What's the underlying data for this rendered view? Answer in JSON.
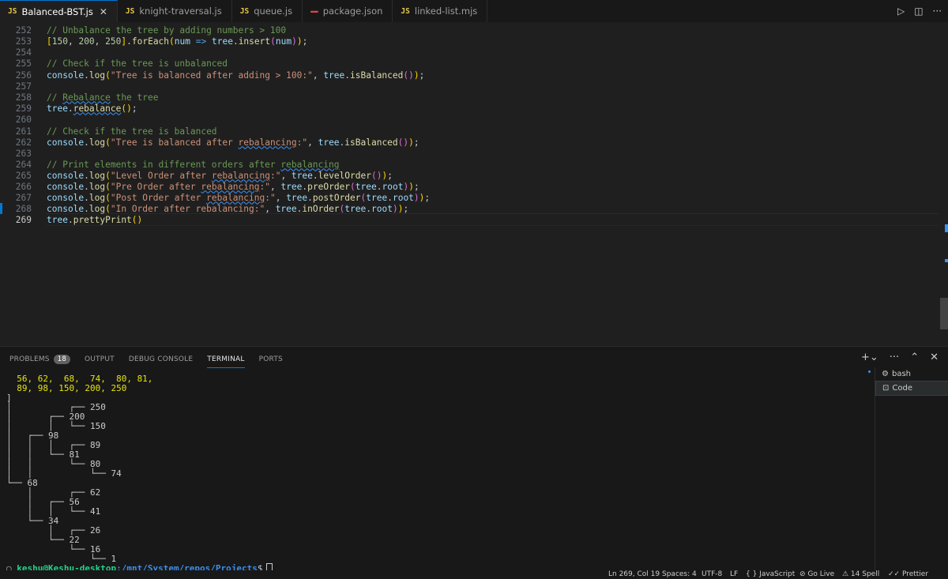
{
  "tabs": [
    {
      "icon": "JS",
      "label": "Balanced-BST.js",
      "active": true,
      "close": "✕"
    },
    {
      "icon": "JS",
      "label": "knight-traversal.js"
    },
    {
      "icon": "JS",
      "label": "queue.js"
    },
    {
      "icon": "json-icon",
      "label": "package.json"
    },
    {
      "icon": "JS",
      "label": "linked-list.mjs"
    }
  ],
  "tab_actions": {
    "run": "▷",
    "split": "◫",
    "more": "···"
  },
  "editor": {
    "lines": [
      {
        "n": "252",
        "code": "// Unbalance the tree by adding numbers > 100"
      },
      {
        "n": "253",
        "code": "[150, 200, 250].forEach(num => tree.insert(num));"
      },
      {
        "n": "254",
        "code": ""
      },
      {
        "n": "255",
        "code": "// Check if the tree is unbalanced"
      },
      {
        "n": "256",
        "code": "console.log(\"Tree is balanced after adding > 100:\", tree.isBalanced());"
      },
      {
        "n": "257",
        "code": ""
      },
      {
        "n": "258",
        "code": "// Rebalance the tree"
      },
      {
        "n": "259",
        "code": "tree.rebalance();"
      },
      {
        "n": "260",
        "code": ""
      },
      {
        "n": "261",
        "code": "// Check if the tree is balanced"
      },
      {
        "n": "262",
        "code": "console.log(\"Tree is balanced after rebalancing:\", tree.isBalanced());"
      },
      {
        "n": "263",
        "code": ""
      },
      {
        "n": "264",
        "code": "// Print elements in different orders after rebalancing"
      },
      {
        "n": "265",
        "code": "console.log(\"Level Order after rebalancing:\", tree.levelOrder());"
      },
      {
        "n": "266",
        "code": "console.log(\"Pre Order after rebalancing:\", tree.preOrder(tree.root));"
      },
      {
        "n": "267",
        "code": "console.log(\"Post Order after rebalancing:\", tree.postOrder(tree.root));"
      },
      {
        "n": "268",
        "code": "console.log(\"In Order after rebalancing:\", tree.inOrder(tree.root));"
      },
      {
        "n": "269",
        "code": "tree.prettyPrint()"
      }
    ]
  },
  "panel": {
    "tabs": [
      "PROBLEMS",
      "OUTPUT",
      "DEBUG CONSOLE",
      "TERMINAL",
      "PORTS"
    ],
    "problems_count": "18",
    "actions": [
      "+⌄",
      "···",
      "⌃",
      "✕"
    ]
  },
  "terminal": {
    "lines": [
      "  56, 62,  68,  74,  80, 81,",
      "  89, 98, 150, 200, 250",
      "]",
      "│           ┌── 250",
      "│       ┌── 200",
      "│       │   └── 150",
      "│   ┌── 98",
      "│   │   │   ┌── 89",
      "│   │   └── 81",
      "│   │       └── 80",
      "│   │           └── 74",
      "└── 68",
      "    │       ┌── 62",
      "    │   ┌── 56",
      "    │   │   └── 41",
      "    └── 34",
      "        │   ┌── 26",
      "        └── 22",
      "            └── 16",
      "                └── 1"
    ],
    "prompt_user": "keshu@Keshu-desktop",
    "prompt_path": ":/mnt/System/repos/Projects",
    "prompt_symbol": "$",
    "sessions": [
      {
        "icon": "⚙",
        "label": "bash"
      },
      {
        "icon": "⊡",
        "label": "Code",
        "active": true
      }
    ]
  },
  "status": {
    "position": "Ln 269, Col 19",
    "spaces": "Spaces: 4",
    "encoding": "UTF-8",
    "eol": "LF",
    "language": "{ } JavaScript",
    "golive": "⊘ Go Live",
    "spell": "⚠ 14 Spell",
    "prettier": "✓✓ Prettier"
  }
}
